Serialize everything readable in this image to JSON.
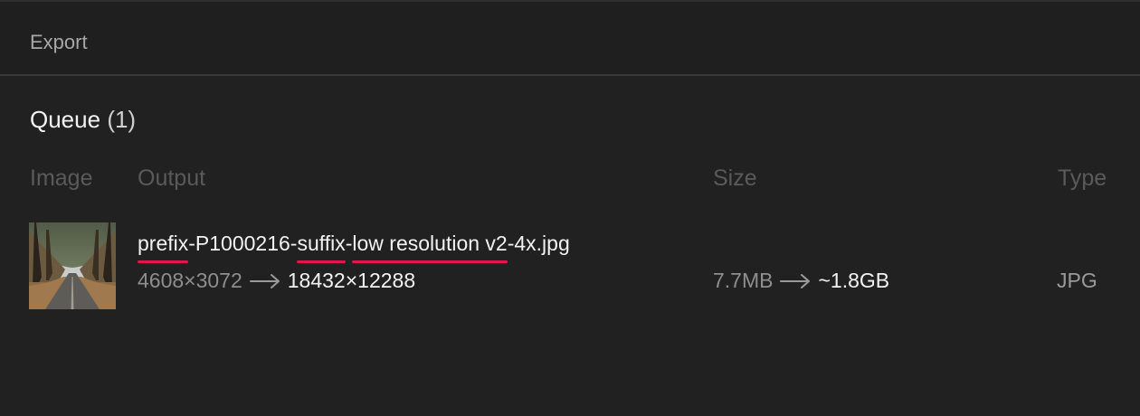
{
  "header": {
    "title": "Export"
  },
  "queue": {
    "label": "Queue",
    "count": "(1)"
  },
  "columns": {
    "image": "Image",
    "output": "Output",
    "size": "Size",
    "type": "Type"
  },
  "rows": [
    {
      "filename_parts": [
        "prefix",
        "-P1000216-",
        "suffix",
        "-",
        "low resolution v2",
        "-4x.jpg"
      ],
      "input_resolution": "4608×3072",
      "output_resolution": "18432×12288",
      "input_size": "7.7MB",
      "output_size": "~1.8GB",
      "type": "JPG",
      "thumbnail_icon": "photo-thumbnail"
    }
  ],
  "colors": {
    "accent_underline": "#e0174f",
    "background": "#212121"
  }
}
